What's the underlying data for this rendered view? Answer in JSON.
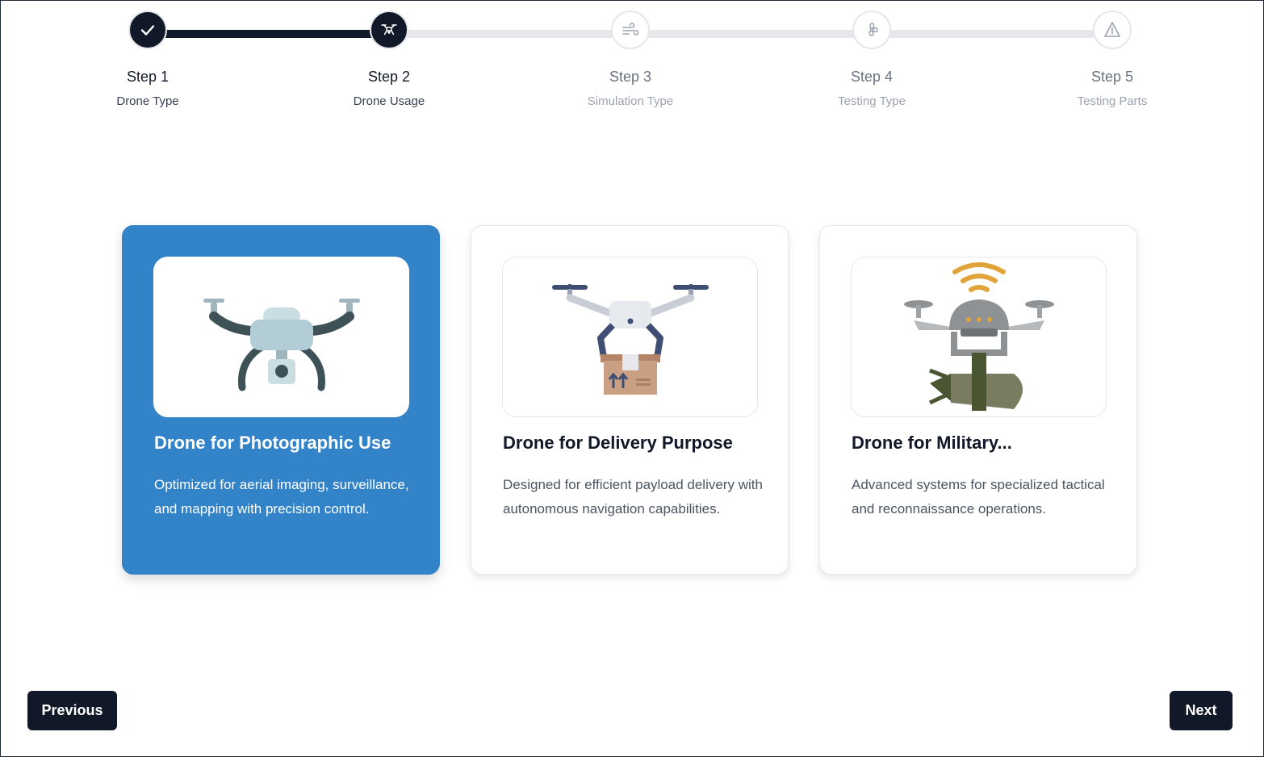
{
  "stepper": {
    "steps": [
      {
        "title": "Step 1",
        "subtitle": "Drone Type",
        "state": "done",
        "icon": "check-icon"
      },
      {
        "title": "Step 2",
        "subtitle": "Drone Usage",
        "state": "active",
        "icon": "drone-icon"
      },
      {
        "title": "Step 3",
        "subtitle": "Simulation Type",
        "state": "pending",
        "icon": "wind-icon"
      },
      {
        "title": "Step 4",
        "subtitle": "Testing Type",
        "state": "pending",
        "icon": "fan-icon"
      },
      {
        "title": "Step 5",
        "subtitle": "Testing Parts",
        "state": "pending",
        "icon": "warning-triangle-icon"
      }
    ]
  },
  "cards": [
    {
      "title": "Drone for Photographic Use",
      "description": "Optimized for aerial imaging, surveillance, and mapping with precision control.",
      "selected": true,
      "image": "camera-drone-illustration"
    },
    {
      "title": "Drone for Delivery Purpose",
      "description": "Designed for efficient payload delivery with autonomous navigation capabilities.",
      "selected": false,
      "image": "delivery-drone-illustration"
    },
    {
      "title": "Drone for Military...",
      "description": "Advanced systems for specialized tactical and reconnaissance operations.",
      "selected": false,
      "image": "military-drone-illustration"
    }
  ],
  "buttons": {
    "previous_label": "Previous",
    "next_label": "Next"
  },
  "colors": {
    "primary_dark": "#111827",
    "selected_card": "#3283c7",
    "track": "#e5e7eb"
  }
}
